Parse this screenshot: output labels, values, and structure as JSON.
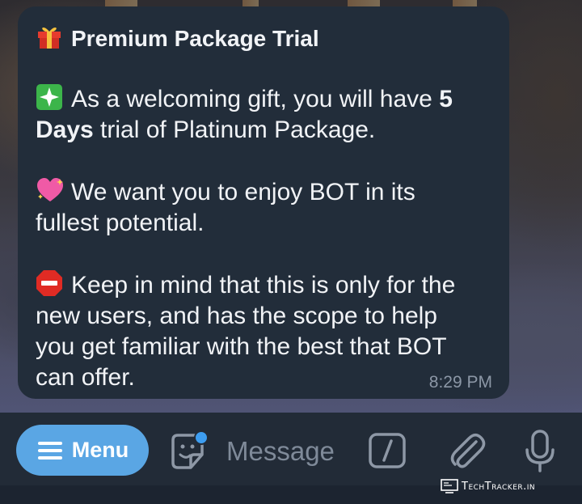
{
  "message": {
    "title": "Premium Package Trial",
    "paragraphs": [
      {
        "icon": "sparkles-icon",
        "lines": [
          [
            {
              "text": "As a welcoming gift, you will have "
            },
            {
              "text": "5",
              "bold": true
            }
          ],
          [
            {
              "text": "Days",
              "bold": true
            },
            {
              "text": " trial of Platinum Package."
            }
          ]
        ]
      },
      {
        "icon": "sparkling-heart-icon",
        "lines": [
          [
            {
              "text": "We want you to enjoy BOT in its"
            }
          ],
          [
            {
              "text": "fullest potential."
            }
          ]
        ]
      },
      {
        "icon": "stop-sign-icon",
        "lines": [
          [
            {
              "text": "Keep in mind that this is only for the"
            }
          ],
          [
            {
              "text": "new users, and has the scope to help"
            }
          ],
          [
            {
              "text": "you get familiar with the best that BOT"
            }
          ],
          [
            {
              "text": "can offer."
            }
          ]
        ]
      }
    ],
    "time": "8:29 PM"
  },
  "input_bar": {
    "menu_label": "Menu",
    "placeholder": "Message",
    "icons": [
      "sticker-icon",
      "slash-command-icon",
      "paperclip-icon",
      "microphone-icon"
    ]
  },
  "watermark": "TechTracker.in",
  "colors": {
    "bubble": "#222d3a",
    "menu_button": "#5aa6e4",
    "input_bar": "#222b37",
    "text": "#f1f3f6",
    "muted": "#8c97a6"
  }
}
